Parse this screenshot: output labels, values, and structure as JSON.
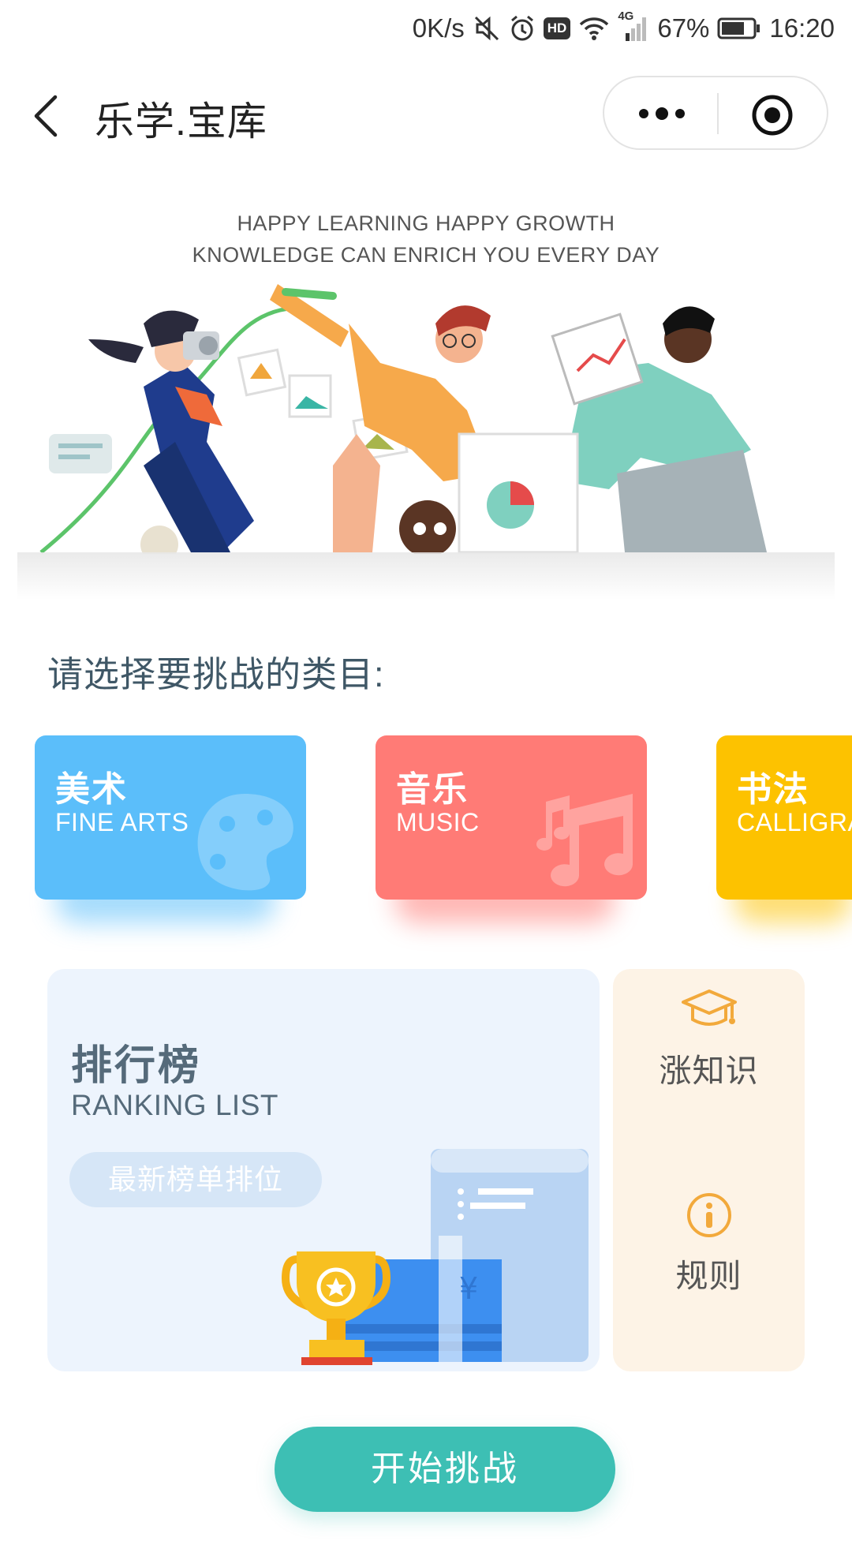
{
  "status_bar": {
    "network_speed": "0K/s",
    "hd_badge": "HD",
    "network_type": "4G",
    "battery": "67%",
    "time": "16:20"
  },
  "nav": {
    "title": "乐学.宝库"
  },
  "hero": {
    "line1": "HAPPY LEARNING HAPPY GROWTH",
    "line2": "KNOWLEDGE CAN ENRICH YOU EVERY DAY"
  },
  "prompt": "请选择要挑战的类目:",
  "categories": [
    {
      "cn": "美术",
      "en": "FINE ARTS",
      "color": "#5bbefa"
    },
    {
      "cn": "音乐",
      "en": "MUSIC",
      "color": "#ff7b76"
    },
    {
      "cn": "书法",
      "en": "CALLIGRAPHY",
      "color": "#fdc200"
    }
  ],
  "ranking": {
    "cn": "排行榜",
    "en": "RANKING LIST",
    "pill": "最新榜单排位",
    "currency_symbol": "¥"
  },
  "side_menu": {
    "knowledge_label": "涨知识",
    "rules_label": "规则"
  },
  "start_button": "开始挑战",
  "colors": {
    "accent": "#3dbfb4",
    "ranking_bg": "#edf4fd",
    "side_bg": "#fdf3e6",
    "side_icon": "#f2a93b"
  }
}
